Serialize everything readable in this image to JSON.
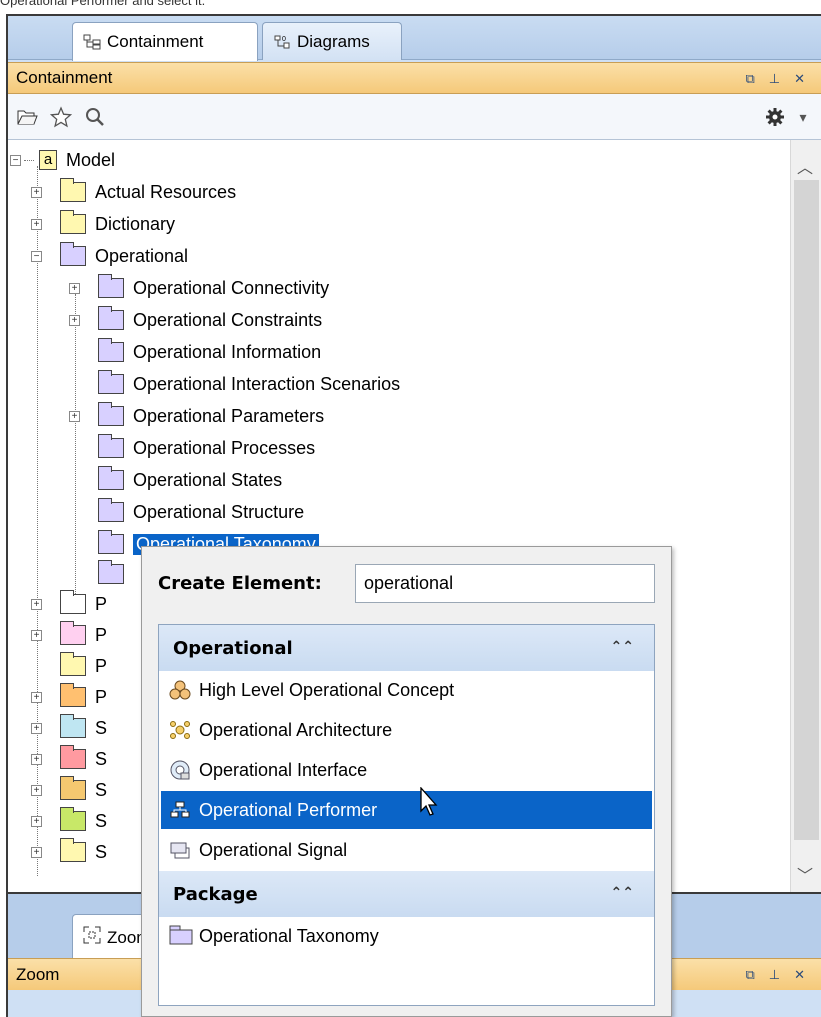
{
  "caption": "Operational Performer and select it.",
  "tabs": [
    {
      "label": "Containment",
      "active": true
    },
    {
      "label": "Diagrams",
      "active": false
    }
  ],
  "containment_panel": {
    "title": "Containment",
    "controls": [
      "restore-icon",
      "pin-icon",
      "close-icon"
    ]
  },
  "toolbar": {
    "left_icons": [
      "open-icon",
      "star-icon",
      "search-icon"
    ],
    "right_icon": "gear-icon"
  },
  "tree": {
    "root": "Model",
    "items": [
      {
        "label": "Actual Resources"
      },
      {
        "label": "Dictionary"
      },
      {
        "label": "Operational"
      },
      {
        "label": "Operational Connectivity"
      },
      {
        "label": "Operational Constraints"
      },
      {
        "label": "Operational Information"
      },
      {
        "label": "Operational Interaction Scenarios"
      },
      {
        "label": "Operational Parameters"
      },
      {
        "label": "Operational Processes"
      },
      {
        "label": "Operational States"
      },
      {
        "label": "Operational Structure"
      },
      {
        "label": "Operational Taxonomy"
      }
    ],
    "truncated_items": [
      "P",
      "P",
      "P",
      "P",
      "S",
      "S",
      "S",
      "S",
      "S"
    ]
  },
  "zoom_panel": {
    "tab_label": "Zoom",
    "title": "Zoom"
  },
  "popup": {
    "create_label": "Create Element:",
    "input_value": "operational",
    "groups": [
      {
        "name": "Operational",
        "items": [
          {
            "label": "High Level Operational Concept",
            "icon": "concept-icon"
          },
          {
            "label": "Operational Architecture",
            "icon": "architecture-icon"
          },
          {
            "label": "Operational Interface",
            "icon": "interface-icon"
          },
          {
            "label": "Operational Performer",
            "icon": "performer-icon",
            "selected": true
          },
          {
            "label": "Operational Signal",
            "icon": "signal-icon"
          }
        ]
      },
      {
        "name": "Package",
        "items": [
          {
            "label": "Operational Taxonomy",
            "icon": "package-icon"
          }
        ]
      }
    ]
  },
  "colors": {
    "selection": "#0a64c8",
    "panel_title": "#f5c97a",
    "tab_strip": "#b6cdea"
  }
}
